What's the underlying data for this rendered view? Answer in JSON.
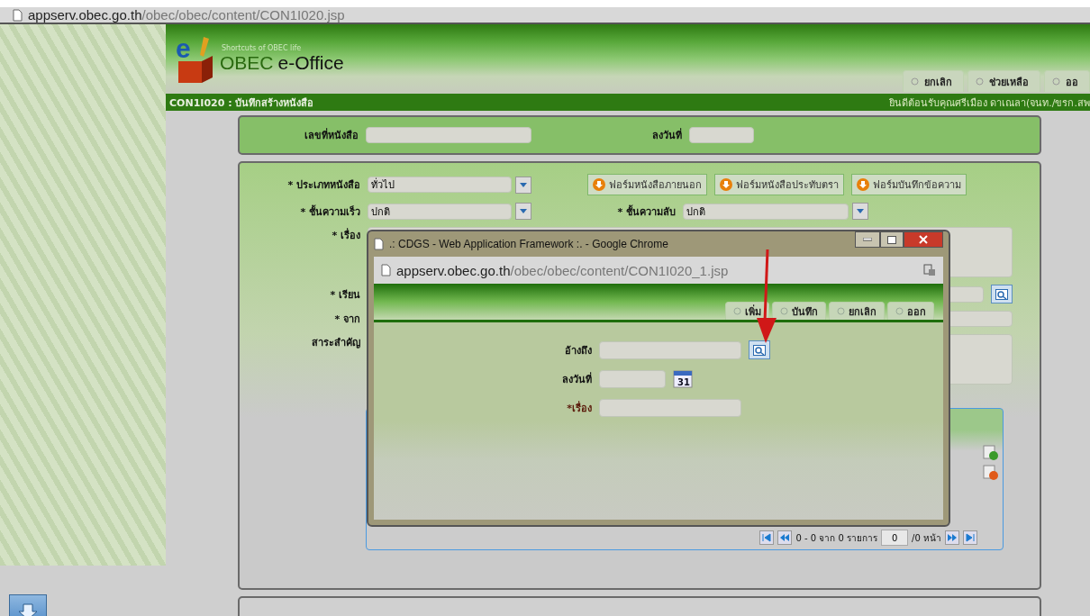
{
  "address_bar": {
    "host": "appserv.obec.go.th",
    "path": "/obec/obec/content/CON1I020.jsp"
  },
  "header": {
    "logo_letter": "e",
    "tagline": "Shortcuts of OBEC life",
    "brand": "OBEC",
    "product": "e-Office",
    "buttons": [
      "ยกเลิก",
      "ช่วยเหลือ",
      "ออ"
    ]
  },
  "title_bar": {
    "title": "CON1I020 : บันทึกสร้างหนังสือ",
    "welcome": "ยินดีต้อนรับคุณศรีเมือง ดาเณลา(จนท./ขรก.สพ"
  },
  "document_panel": {
    "number_label": "เลขที่หนังสือ",
    "date_label": "ลงวันที่"
  },
  "form": {
    "type_label": "* ประเภทหนังสือ",
    "type_value": "ทั่วไป",
    "form_buttons": [
      "ฟอร์มหนังสือภายนอก",
      "ฟอร์มหนังสือประทับตรา",
      "ฟอร์มบันทึกข้อความ"
    ],
    "speed_label": "* ชั้นความเร็ว",
    "speed_value": "ปกติ",
    "secret_label": "* ชั้นความลับ",
    "secret_value": "ปกติ",
    "subject_label": "* เรื่อง",
    "to_label": "* เรียน",
    "from_label": "* จาก",
    "summary_label": "สาระสำคัญ"
  },
  "pagination": {
    "summary": "0 - 0 จาก 0 รายการ",
    "page": "0",
    "pages": "/0 หน้า"
  },
  "popup": {
    "title": ".: CDGS - Web Application Framework :. - Google Chrome",
    "host": "appserv.obec.go.th",
    "path": "/obec/obec/content/CON1I020_1.jsp",
    "buttons": [
      "เพิ่ม",
      "บันทึก",
      "ยกเลิก",
      "ออก"
    ],
    "reference_label": "อ้างถึง",
    "date_label": "ลงวันที่",
    "calendar_day": "31",
    "subject_label": "*เรื่อง"
  }
}
